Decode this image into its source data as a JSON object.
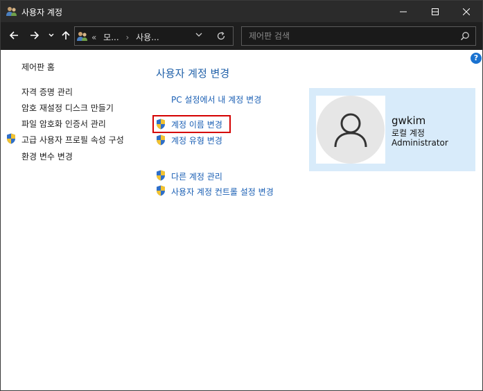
{
  "window": {
    "title": "사용자 계정"
  },
  "address_bar": {
    "prefix": "«",
    "crumbs": [
      "모...",
      "사용..."
    ],
    "separator": "›"
  },
  "search": {
    "placeholder": "제어판 검색"
  },
  "help": {
    "label": "?"
  },
  "sidebar": {
    "home": "제어판 홈",
    "links": [
      "자격 증명 관리",
      "암호 재설정 디스크 만들기",
      "파일 암호화 인증서 관리",
      "고급 사용자 프로필 속성 구성",
      "환경 변수 변경"
    ]
  },
  "main": {
    "heading": "사용자 계정 변경",
    "pc_settings_link": "PC 설정에서 내 계정 변경",
    "change_name_link": "계정 이름 변경",
    "change_type_link": "계정 유형 변경",
    "manage_accounts_link": "다른 계정 관리",
    "uac_settings_link": "사용자 계정 컨트롤 설정 변경"
  },
  "user": {
    "name": "gwkim",
    "account_type": "로컬 계정",
    "role": "Administrator"
  },
  "colors": {
    "title_bar": "#2b2b2b",
    "nav_bar": "#1f1f1f",
    "link": "#1a5fb4",
    "heading": "#1e5fa8",
    "user_panel": "#d8ebfa",
    "highlight": "#d40000"
  }
}
